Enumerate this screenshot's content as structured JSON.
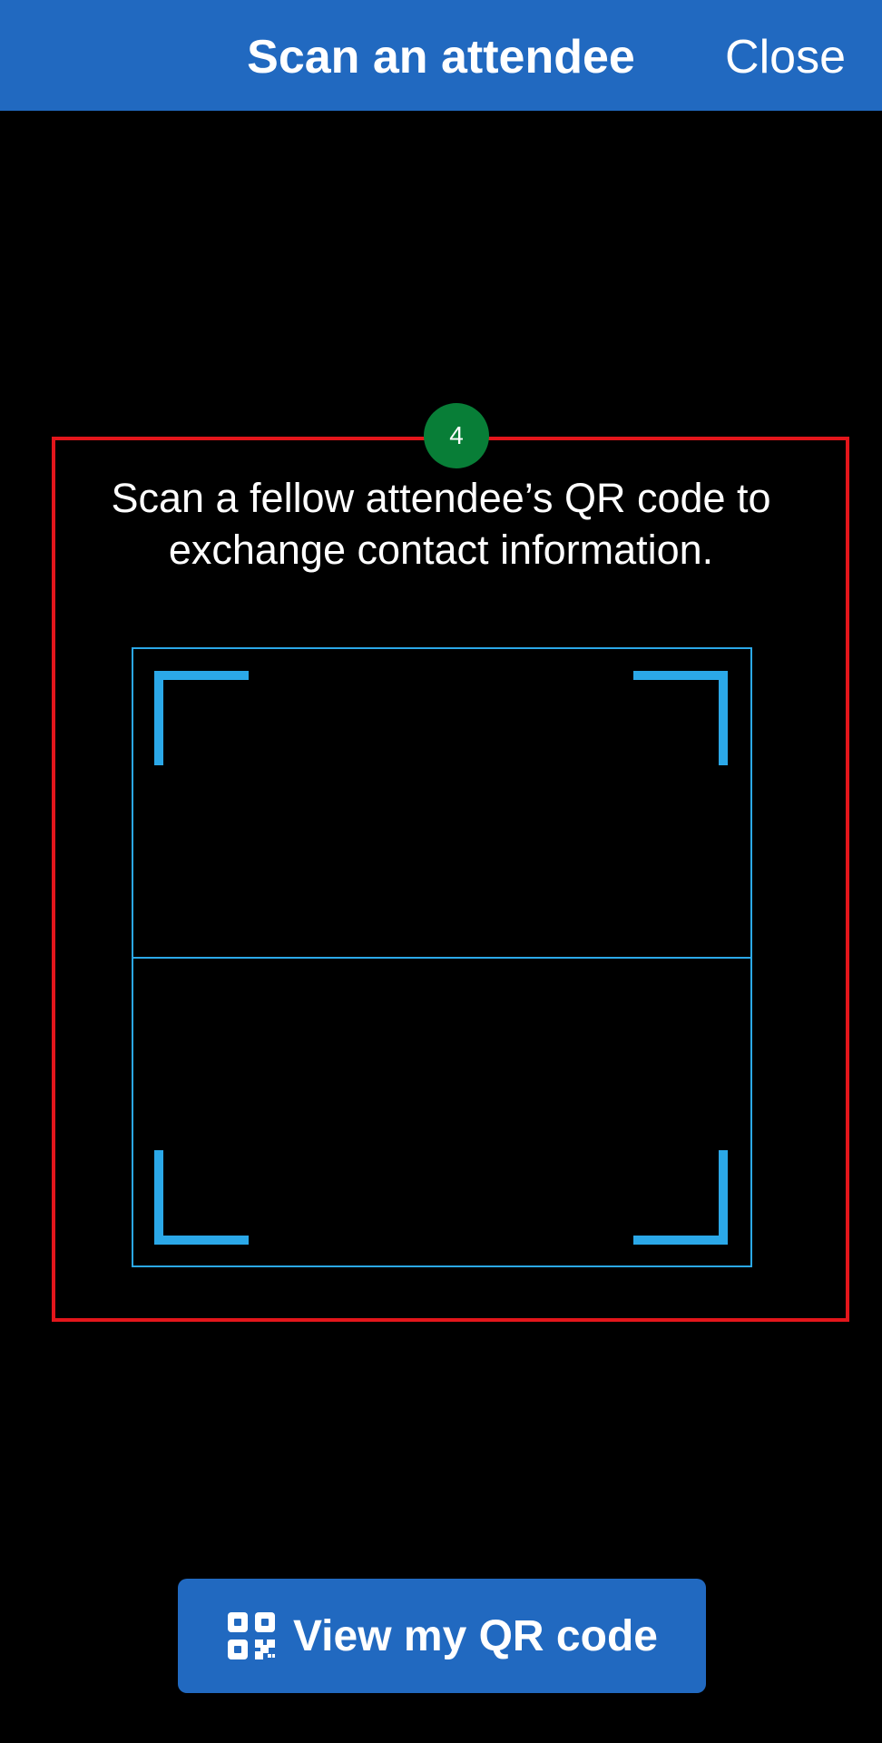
{
  "header": {
    "title": "Scan an attendee",
    "close_label": "Close"
  },
  "step_badge": "4",
  "instruction": "Scan a fellow attendee’s QR code to exchange contact information.",
  "view_qr_button": {
    "label": "View my QR code",
    "icon": "qr-code-icon"
  },
  "colors": {
    "header_bg": "#2169C0",
    "button_bg": "#2169C0",
    "scanner_frame": "#2BA8E8",
    "highlight_border": "#E3161B",
    "badge_bg": "#087E37",
    "background": "#000000"
  }
}
